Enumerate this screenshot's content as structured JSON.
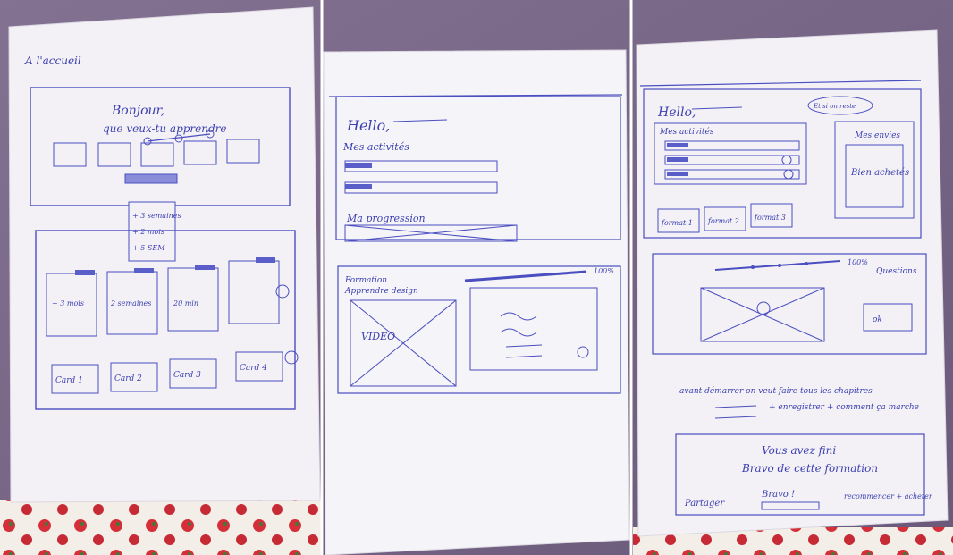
{
  "sheets": [
    {
      "corner_note": "A l'accueil",
      "greeting_line1": "Bonjour,",
      "greeting_line2": "que veux-tu apprendre",
      "popover_items": [
        "+ 3 semaines",
        "+ 2 mois",
        "+ 5 SEM"
      ],
      "card_notes": [
        "+ 3 mois",
        "2 semaines",
        "20 min"
      ],
      "tiles": [
        "Card 1",
        "Card 2",
        "Card 3",
        "Card 4"
      ]
    },
    {
      "greeting": "Hello,",
      "section_activities": "Mes activités",
      "section_progress": "Ma progression",
      "course_title": "Formation",
      "course_subtitle": "Apprendre design",
      "progress_label": "100%",
      "video_label": "VIDEO"
    },
    {
      "greeting": "Hello,",
      "annotation": "Et si on reste",
      "activities_label": "Mes activités",
      "side_title": "Mes envies",
      "side_body": "Bien achetés",
      "tabs": [
        "format 1",
        "format 2",
        "format 3"
      ],
      "progress_label": "100%",
      "questions_label": "Questions",
      "ok_label": "ok",
      "note_line1": "avant démarrer on veut faire tous les chapitres",
      "note_line2": "+ enregistrer + comment ça marche",
      "footer_line1": "Vous avez fini",
      "footer_line2": "Bravo de cette formation",
      "footer_left": "Partager",
      "footer_center": "Bravo !",
      "footer_right": "recommencer + acheter"
    }
  ]
}
